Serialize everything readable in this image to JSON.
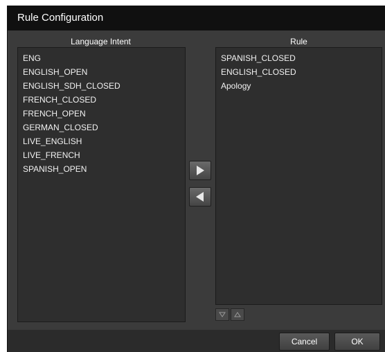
{
  "window": {
    "title": "Rule Configuration"
  },
  "left_panel": {
    "header": "Language Intent",
    "items": [
      "ENG",
      "ENGLISH_OPEN",
      "ENGLISH_SDH_CLOSED",
      "FRENCH_CLOSED",
      "FRENCH_OPEN",
      "GERMAN_CLOSED",
      "LIVE_ENGLISH",
      "LIVE_FRENCH",
      "SPANISH_OPEN"
    ]
  },
  "right_panel": {
    "header": "Rule",
    "items": [
      "SPANISH_CLOSED",
      "ENGLISH_CLOSED",
      "Apology"
    ]
  },
  "transfer_buttons": {
    "move_right_icon": "triangle-right-icon",
    "move_left_icon": "triangle-left-icon"
  },
  "order_buttons": {
    "down_icon": "triangle-down-icon",
    "up_icon": "triangle-up-icon"
  },
  "footer": {
    "cancel_label": "Cancel",
    "ok_label": "OK"
  },
  "colors": {
    "title_bar": "#101010",
    "panel_bg": "#3b3b3b",
    "list_bg": "#2e2e2e",
    "text": "#f2f2f2"
  }
}
